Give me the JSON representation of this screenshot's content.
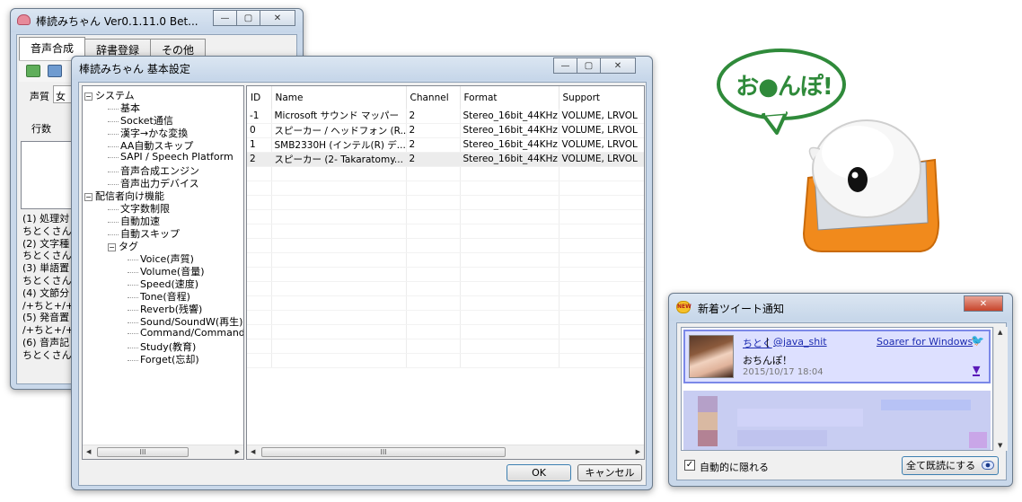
{
  "main_window": {
    "title": "棒読みちゃん Ver0.1.11.0 Bet...",
    "tabs": [
      "音声合成",
      "辞書登録",
      "その他"
    ],
    "voice_label": "声質",
    "voice_value": "女",
    "lines_label": "行数",
    "log_lines": [
      "(1) 処理対",
      "ちとくさんの",
      "(2) 文字種",
      "ちとくさんの",
      "(3) 単語置",
      "ちとくさんの",
      "(4) 文節分",
      "/+ちと+/+く",
      "(5) 発音置",
      "/+ちと+/+く",
      "(6) 音声記",
      "ちとくさん"
    ]
  },
  "settings_window": {
    "title": "棒読みちゃん 基本設定",
    "tree": [
      {
        "label": "システム",
        "level": 0,
        "toggle": "−"
      },
      {
        "label": "基本",
        "level": 1
      },
      {
        "label": "Socket通信",
        "level": 1
      },
      {
        "label": "漢字→かな変換",
        "level": 1
      },
      {
        "label": "AA自動スキップ",
        "level": 1
      },
      {
        "label": "SAPI / Speech Platform",
        "level": 1
      },
      {
        "label": "音声合成エンジン",
        "level": 1
      },
      {
        "label": "音声出力デバイス",
        "level": 1
      },
      {
        "label": "配信者向け機能",
        "level": 0,
        "toggle": "−"
      },
      {
        "label": "文字数制限",
        "level": 1
      },
      {
        "label": "自動加速",
        "level": 1
      },
      {
        "label": "自動スキップ",
        "level": 1
      },
      {
        "label": "タグ",
        "level": 1,
        "toggle": "−"
      },
      {
        "label": "Voice(声質)",
        "level": 2
      },
      {
        "label": "Volume(音量)",
        "level": 2
      },
      {
        "label": "Speed(速度)",
        "level": 2
      },
      {
        "label": "Tone(音程)",
        "level": 2
      },
      {
        "label": "Reverb(残響)",
        "level": 2
      },
      {
        "label": "Sound/SoundW(再生)",
        "level": 2
      },
      {
        "label": "Command/CommandW",
        "level": 2
      },
      {
        "label": "Study(教育)",
        "level": 2
      },
      {
        "label": "Forget(忘却)",
        "level": 2
      }
    ],
    "columns": [
      "ID",
      "Name",
      "Channel",
      "Format",
      "Support"
    ],
    "rows": [
      {
        "id": "-1",
        "name": "Microsoft サウンド マッパー",
        "channel": "2",
        "format": "Stereo_16bit_44KHz",
        "support": "VOLUME, LRVOL"
      },
      {
        "id": "0",
        "name": "スピーカー / ヘッドフォン (R...",
        "channel": "2",
        "format": "Stereo_16bit_44KHz",
        "support": "VOLUME, LRVOL"
      },
      {
        "id": "1",
        "name": "SMB2330H (インテル(R) デ...",
        "channel": "2",
        "format": "Stereo_16bit_44KHz",
        "support": "VOLUME, LRVOL"
      },
      {
        "id": "2",
        "name": "スピーカー (2- Takaratomy...",
        "channel": "2",
        "format": "Stereo_16bit_44KHz",
        "support": "VOLUME, LRVOL"
      }
    ],
    "ok_label": "OK",
    "cancel_label": "キャンセル",
    "scroll_thumb_glyph": "III"
  },
  "mascot": {
    "speech_text": "お●んぽ!",
    "bubble_color": "#2f8a3a"
  },
  "tweet_window": {
    "title": "新着ツイート通知",
    "user": "ちとく",
    "separator": " | ",
    "handle": "@java_shit",
    "client": "Soarer for Windows",
    "text": "おちんぽ！",
    "timestamp": "2015/10/17 18:04",
    "auto_hide_label": "自動的に隠れる",
    "auto_hide_checked": true,
    "mark_all_read_label": "全て既読にする"
  },
  "icons": [
    "bobo-app-icon",
    "play-icon",
    "twitter-bird-icon",
    "eye-icon",
    "new-badge-icon",
    "expand-triangle-icon"
  ]
}
